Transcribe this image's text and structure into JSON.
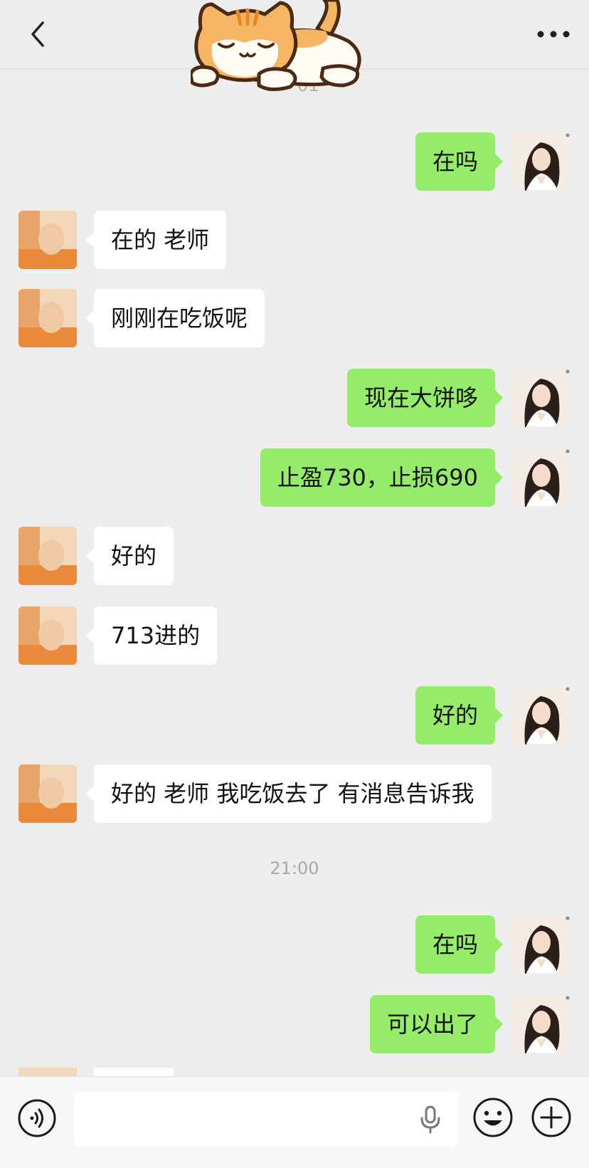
{
  "header": {
    "partial_time": "01"
  },
  "messages": [
    {
      "side": "right",
      "text": "在吗"
    },
    {
      "side": "left",
      "text": "在的 老师"
    },
    {
      "side": "left",
      "text": "刚刚在吃饭呢"
    },
    {
      "side": "right",
      "text": "现在大饼哆"
    },
    {
      "side": "right",
      "text": "止盈730，止损690"
    },
    {
      "side": "left",
      "text": "好的"
    },
    {
      "side": "left",
      "text": "713进的"
    },
    {
      "side": "right",
      "text": "好的"
    },
    {
      "side": "left",
      "text": "好的 老师 我吃饭去了 有消息告诉我"
    },
    {
      "side": "time",
      "text": "21:00"
    },
    {
      "side": "right",
      "text": "在吗"
    },
    {
      "side": "right",
      "text": "可以出了"
    }
  ],
  "input": {
    "value": "",
    "placeholder": ""
  },
  "icons": {
    "back": "chevron-left-icon",
    "more": "more-dots-icon",
    "voice": "voice-icon",
    "mic": "microphone-icon",
    "emoji": "emoji-icon",
    "plus": "plus-icon"
  },
  "colors": {
    "outgoing_bubble": "#95ec69",
    "incoming_bubble": "#ffffff",
    "background": "#ededed"
  }
}
